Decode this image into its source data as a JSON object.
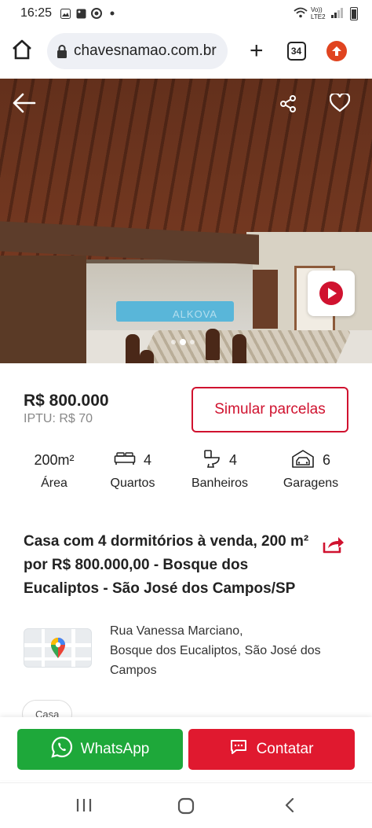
{
  "status_bar": {
    "time": "16:25",
    "network_label": "Vo)) LTE2"
  },
  "browser": {
    "url": "chavesnamao.com.br",
    "tab_count": "34"
  },
  "gallery": {
    "watermark": "ALKOVA",
    "total_images": 3,
    "active_index": 1
  },
  "listing": {
    "price": "R$ 800.000",
    "iptu": "IPTU: R$ 70",
    "simulate_label": "Simular parcelas",
    "features": [
      {
        "icon": "area",
        "value": "200m²",
        "label": "Área"
      },
      {
        "icon": "bed-icon",
        "value": "4",
        "label": "Quartos"
      },
      {
        "icon": "toilet-icon",
        "value": "4",
        "label": "Banheiros"
      },
      {
        "icon": "garage-icon",
        "value": "6",
        "label": "Garagens"
      }
    ],
    "title": "Casa com 4 dormitórios à venda, 200 m² por R$ 800.000,00 - Bosque dos Eucaliptos - São José dos Campos/SP",
    "address_line1": "Rua Vanessa Marciano,",
    "address_line2": "Bosque dos Eucaliptos, São José dos",
    "address_line3": "Campos",
    "tag": "Casa"
  },
  "actions": {
    "whatsapp_label": "WhatsApp",
    "contact_label": "Contatar"
  },
  "colors": {
    "primary_red": "#d0122f",
    "whatsapp_green": "#1ea83a",
    "contact_red": "#e0192f"
  }
}
